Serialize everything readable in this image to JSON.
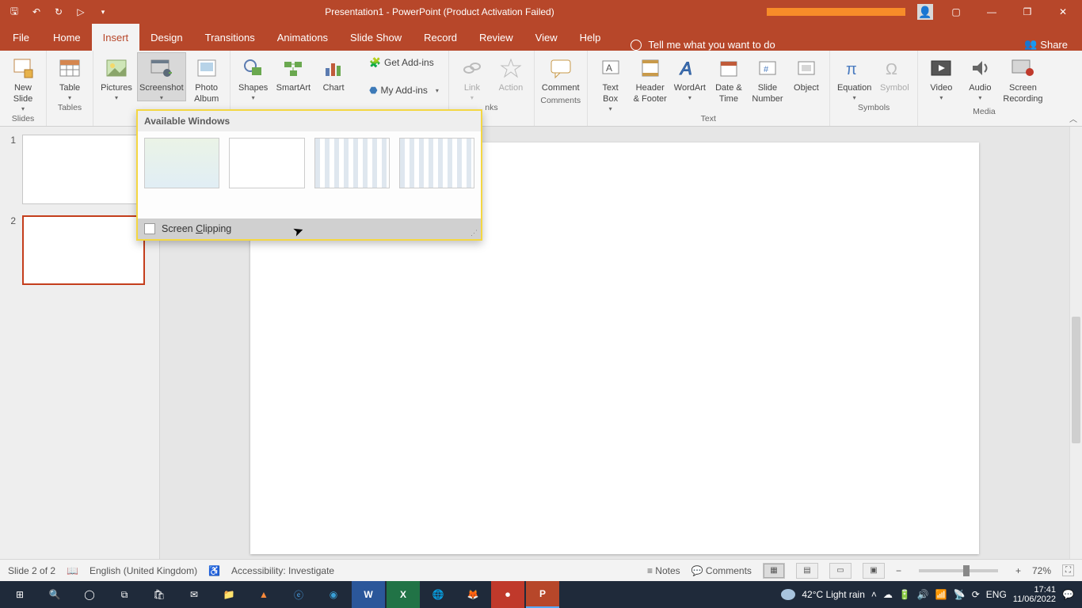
{
  "title": "Presentation1  -  PowerPoint (Product Activation Failed)",
  "tabs": {
    "file": "File",
    "home": "Home",
    "insert": "Insert",
    "design": "Design",
    "transitions": "Transitions",
    "animations": "Animations",
    "slideshow": "Slide Show",
    "record": "Record",
    "review": "Review",
    "view": "View",
    "help": "Help",
    "tellme": "Tell me what you want to do",
    "share": "Share"
  },
  "ribbon": {
    "slides": {
      "new_slide": "New\nSlide",
      "group": "Slides"
    },
    "tables": {
      "table": "Table",
      "group": "Tables"
    },
    "images": {
      "pictures": "Pictures",
      "screenshot": "Screenshot",
      "photo_album": "Photo\nAlbum"
    },
    "illustrations": {
      "shapes": "Shapes",
      "smartart": "SmartArt",
      "chart": "Chart"
    },
    "addins": {
      "get": "Get Add-ins",
      "my": "My Add-ins"
    },
    "links": {
      "link": "Link",
      "action": "Action",
      "group": "nks"
    },
    "comments": {
      "comment": "Comment",
      "group": "Comments"
    },
    "text": {
      "textbox": "Text\nBox",
      "header_footer": "Header\n& Footer",
      "wordart": "WordArt",
      "datetime": "Date &\nTime",
      "slidenum": "Slide\nNumber",
      "object": "Object",
      "group": "Text"
    },
    "symbols": {
      "equation": "Equation",
      "symbol": "Symbol",
      "group": "Symbols"
    },
    "media": {
      "video": "Video",
      "audio": "Audio",
      "screenrec": "Screen\nRecording",
      "group": "Media"
    }
  },
  "shot_panel": {
    "header": "Available Windows",
    "clip": "Screen Clipping"
  },
  "thumbs": {
    "n1": "1",
    "n2": "2"
  },
  "status": {
    "slide_of": "Slide 2 of 2",
    "lang": "English (United Kingdom)",
    "access": "Accessibility: Investigate",
    "notes": "Notes",
    "comments": "Comments",
    "zoom": "72%",
    "minus": "−",
    "plus": "+"
  },
  "tray": {
    "weather": "42°C  Light rain",
    "langcode": "ENG",
    "time": "17:41",
    "date": "11/06/2022"
  }
}
